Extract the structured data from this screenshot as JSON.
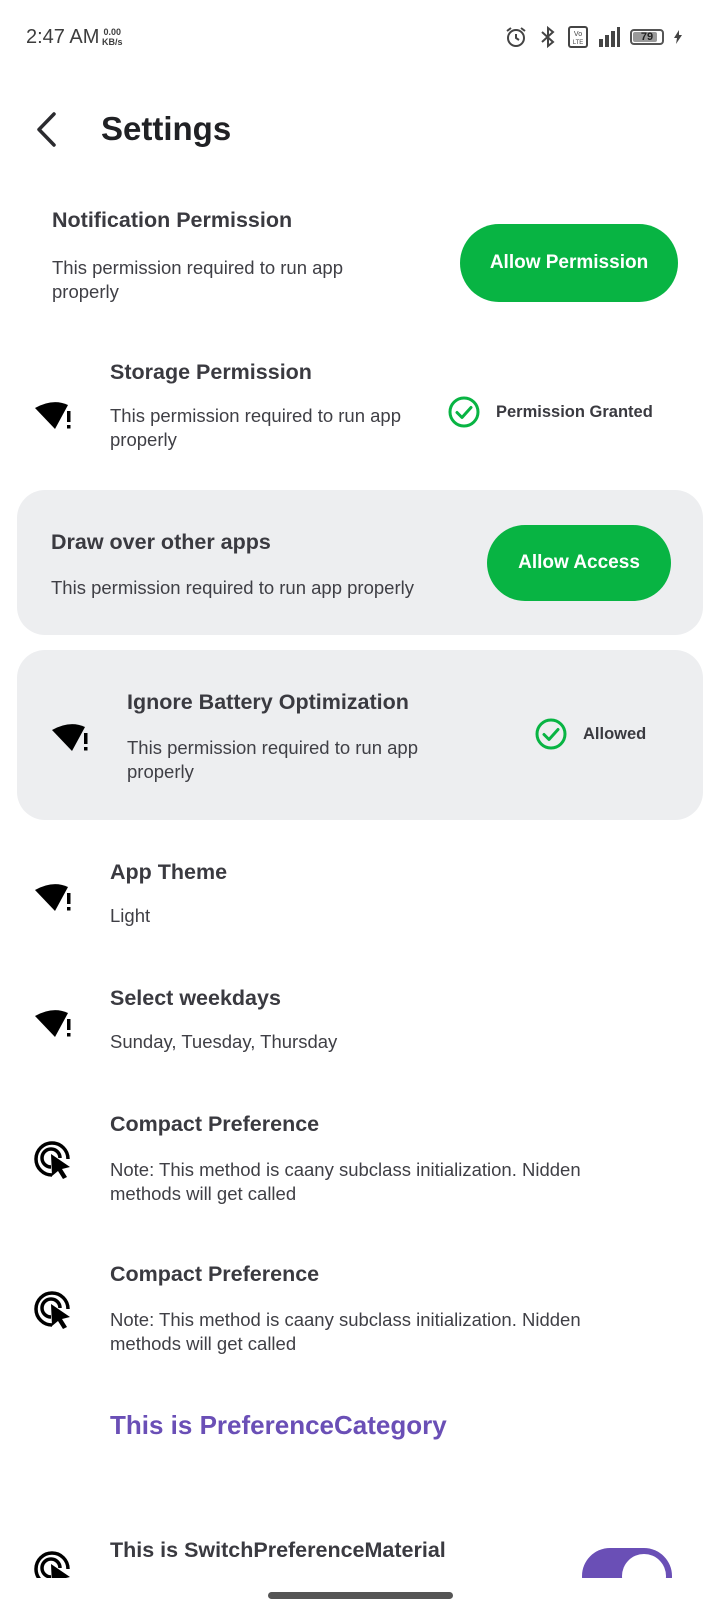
{
  "status": {
    "time": "2:47 AM",
    "speed_value": "0.00",
    "speed_unit": "KB/s",
    "battery": "79",
    "battery_fraction": 0.79
  },
  "header": {
    "title": "Settings"
  },
  "rows": {
    "notification": {
      "title": "Notification Permission",
      "subtitle": "This permission required to run app properly",
      "action": "Allow Permission"
    },
    "storage": {
      "title": "Storage Permission",
      "subtitle": "This permission required to run app properly",
      "status": "Permission Granted"
    },
    "draw_over": {
      "title": "Draw over other apps",
      "subtitle": "This permission required to run app properly",
      "action": "Allow Access"
    },
    "battery_opt": {
      "title": "Ignore Battery Optimization",
      "subtitle": "This permission required to run app properly",
      "status": "Allowed"
    },
    "theme": {
      "title": "App Theme",
      "subtitle": "Light"
    },
    "weekdays": {
      "title": "Select weekdays",
      "subtitle": "Sunday, Tuesday, Thursday"
    },
    "compact1": {
      "title": "Compact Preference",
      "subtitle": "Note: This method is caany subclass initialization. Nidden methods will get called"
    },
    "compact2": {
      "title": "Compact Preference",
      "subtitle": "Note: This method is caany subclass initialization. Nidden methods will get called"
    }
  },
  "category": {
    "title": "This is PreferenceCategory"
  },
  "switch_row": {
    "title": "This is SwitchPreferenceMaterial",
    "checked": true
  },
  "colors": {
    "accent_green": "#08b443",
    "accent_purple": "#6a4fb6",
    "card_bg": "#edeef0"
  },
  "icons": {
    "wifi_alert": "wifi-alert-icon",
    "touch": "touch-app-icon",
    "check": "check-circle-icon",
    "back": "arrow-back-icon"
  }
}
